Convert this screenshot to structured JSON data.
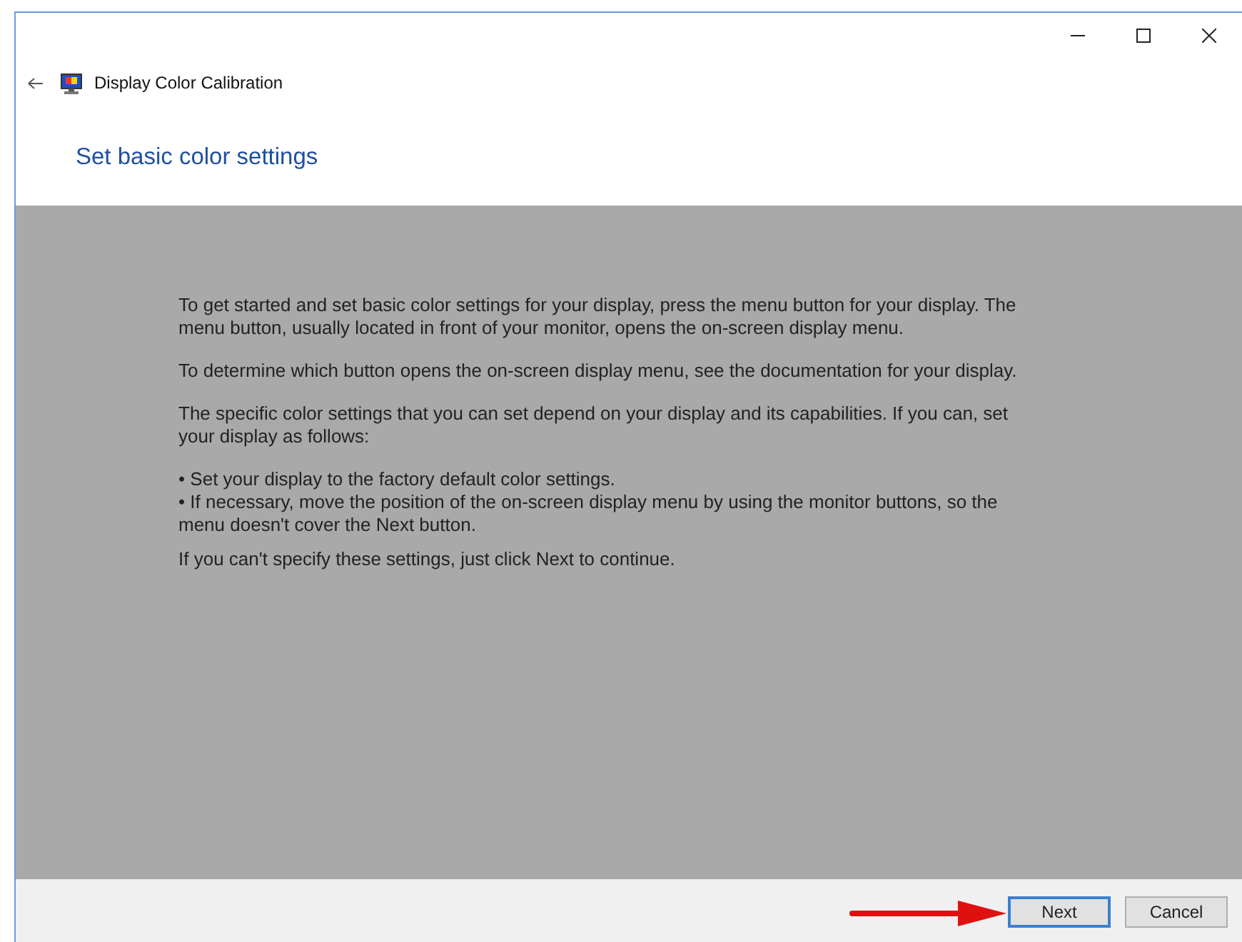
{
  "window": {
    "title": "Display Color Calibration"
  },
  "heading": "Set basic color settings",
  "paragraphs": [
    {
      "kind": "para",
      "text": "To get started and set basic color settings for your display, press the menu button for your display. The menu button, usually located in front of your monitor, opens the on-screen display menu."
    },
    {
      "kind": "para",
      "text": "To determine which button opens the on-screen display menu, see the documentation for your display."
    },
    {
      "kind": "para",
      "text": "The specific color settings that you can set depend on your display and its capabilities. If you can, set your display as follows:"
    },
    {
      "kind": "bullet",
      "text": "• Set your display to the factory default color settings."
    },
    {
      "kind": "bullet",
      "text": "• If necessary, move the position of the on-screen display menu by using the monitor buttons, so the menu doesn't cover the Next button."
    },
    {
      "kind": "para",
      "text": "If you can't specify these settings,  just click Next to continue."
    }
  ],
  "buttons": [
    {
      "label": "Next",
      "selected": true
    },
    {
      "label": "Cancel",
      "selected": false
    }
  ]
}
